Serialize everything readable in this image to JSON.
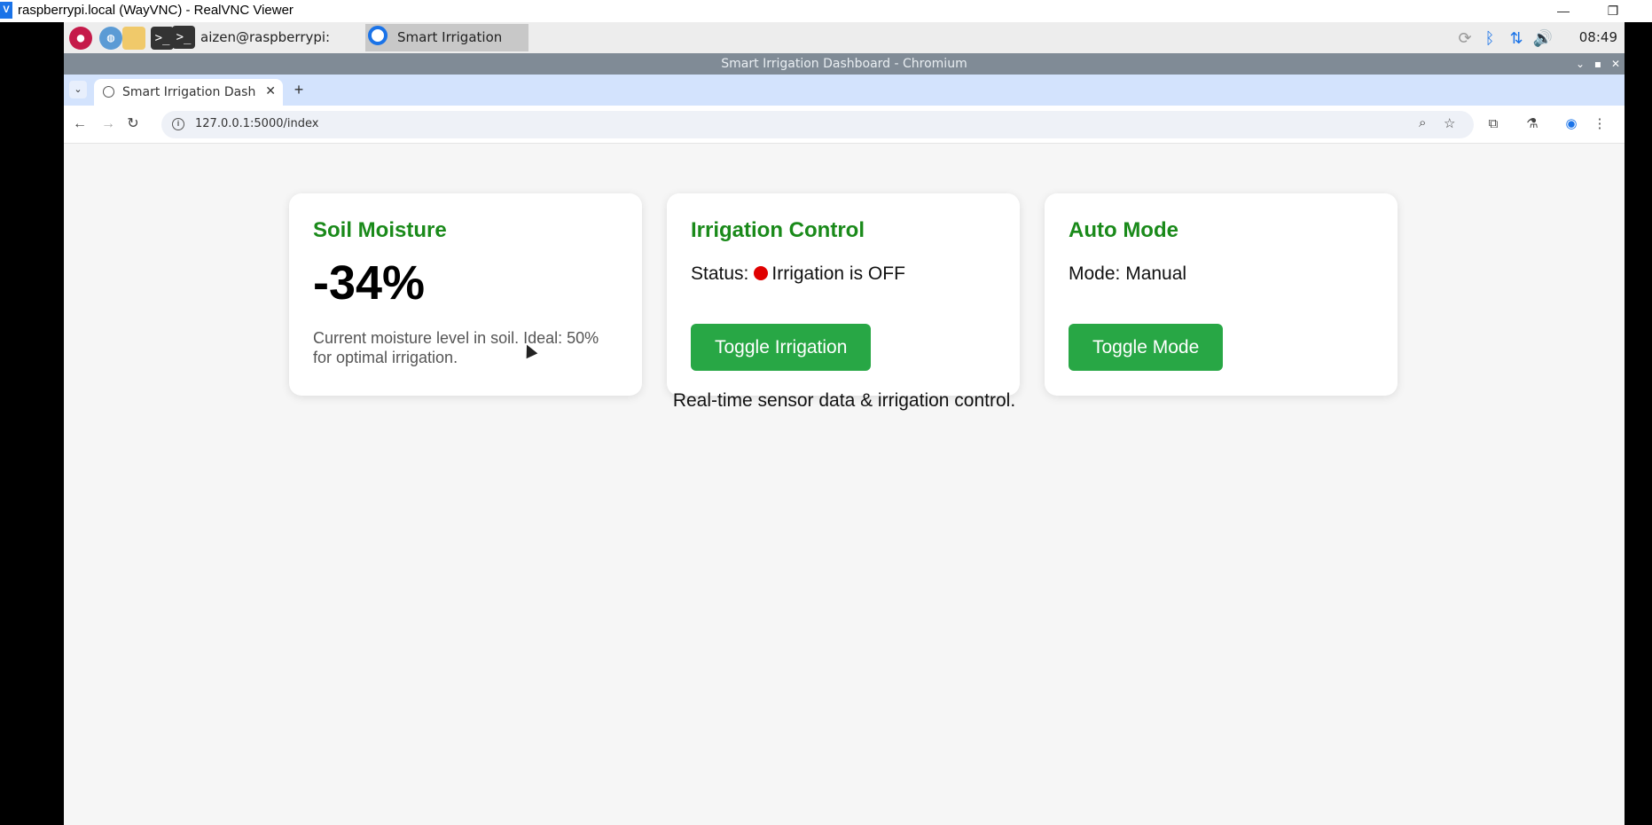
{
  "vnc": {
    "title": "raspberrypi.local (WayVNC) - RealVNC Viewer",
    "logo_letter": "V",
    "minimize": "—",
    "restore": "❐"
  },
  "taskbar": {
    "terminal_task": "aizen@raspberrypi: ~",
    "browser_task": "Smart Irrigation Das..",
    "clock": "08:49"
  },
  "window": {
    "title": "Smart Irrigation Dashboard - Chromium"
  },
  "tabs": {
    "active_label": "Smart Irrigation Dashboard",
    "close": "✕",
    "new_tab": "+"
  },
  "toolbar": {
    "url": "127.0.0.1:5000/index"
  },
  "cards": {
    "soil": {
      "title": "Soil Moisture",
      "value": "-34%",
      "description": "Current moisture level in soil. Ideal: 50% for optimal irrigation."
    },
    "irrigation": {
      "title": "Irrigation Control",
      "status_label": "Status:",
      "status_text": "Irrigation is OFF",
      "button": "Toggle Irrigation"
    },
    "auto": {
      "title": "Auto Mode",
      "mode_text": "Mode: Manual",
      "button": "Toggle Mode"
    }
  },
  "footer": "Real-time sensor data & irrigation control.",
  "colors": {
    "title_green": "#1a8a1a",
    "button_green": "#28a745",
    "status_red": "#e00000"
  }
}
